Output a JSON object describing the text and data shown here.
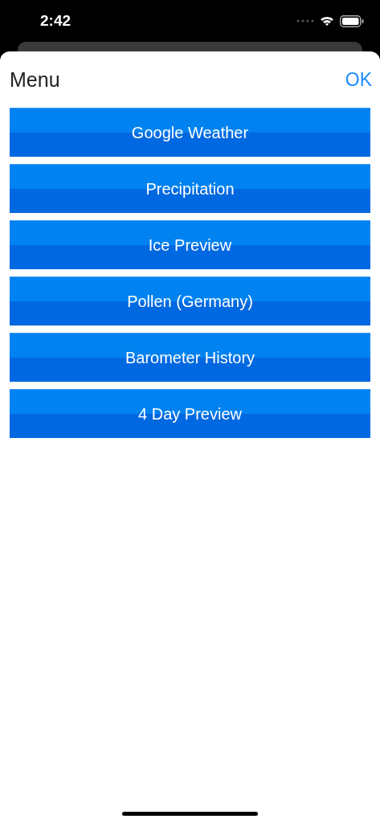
{
  "status_bar": {
    "time": "2:42"
  },
  "header": {
    "title": "Menu",
    "action": "OK"
  },
  "menu_items": [
    "Google Weather",
    "Precipitation",
    "Ice Preview",
    "Pollen (Germany)",
    "Barometer History",
    "4 Day Preview"
  ]
}
